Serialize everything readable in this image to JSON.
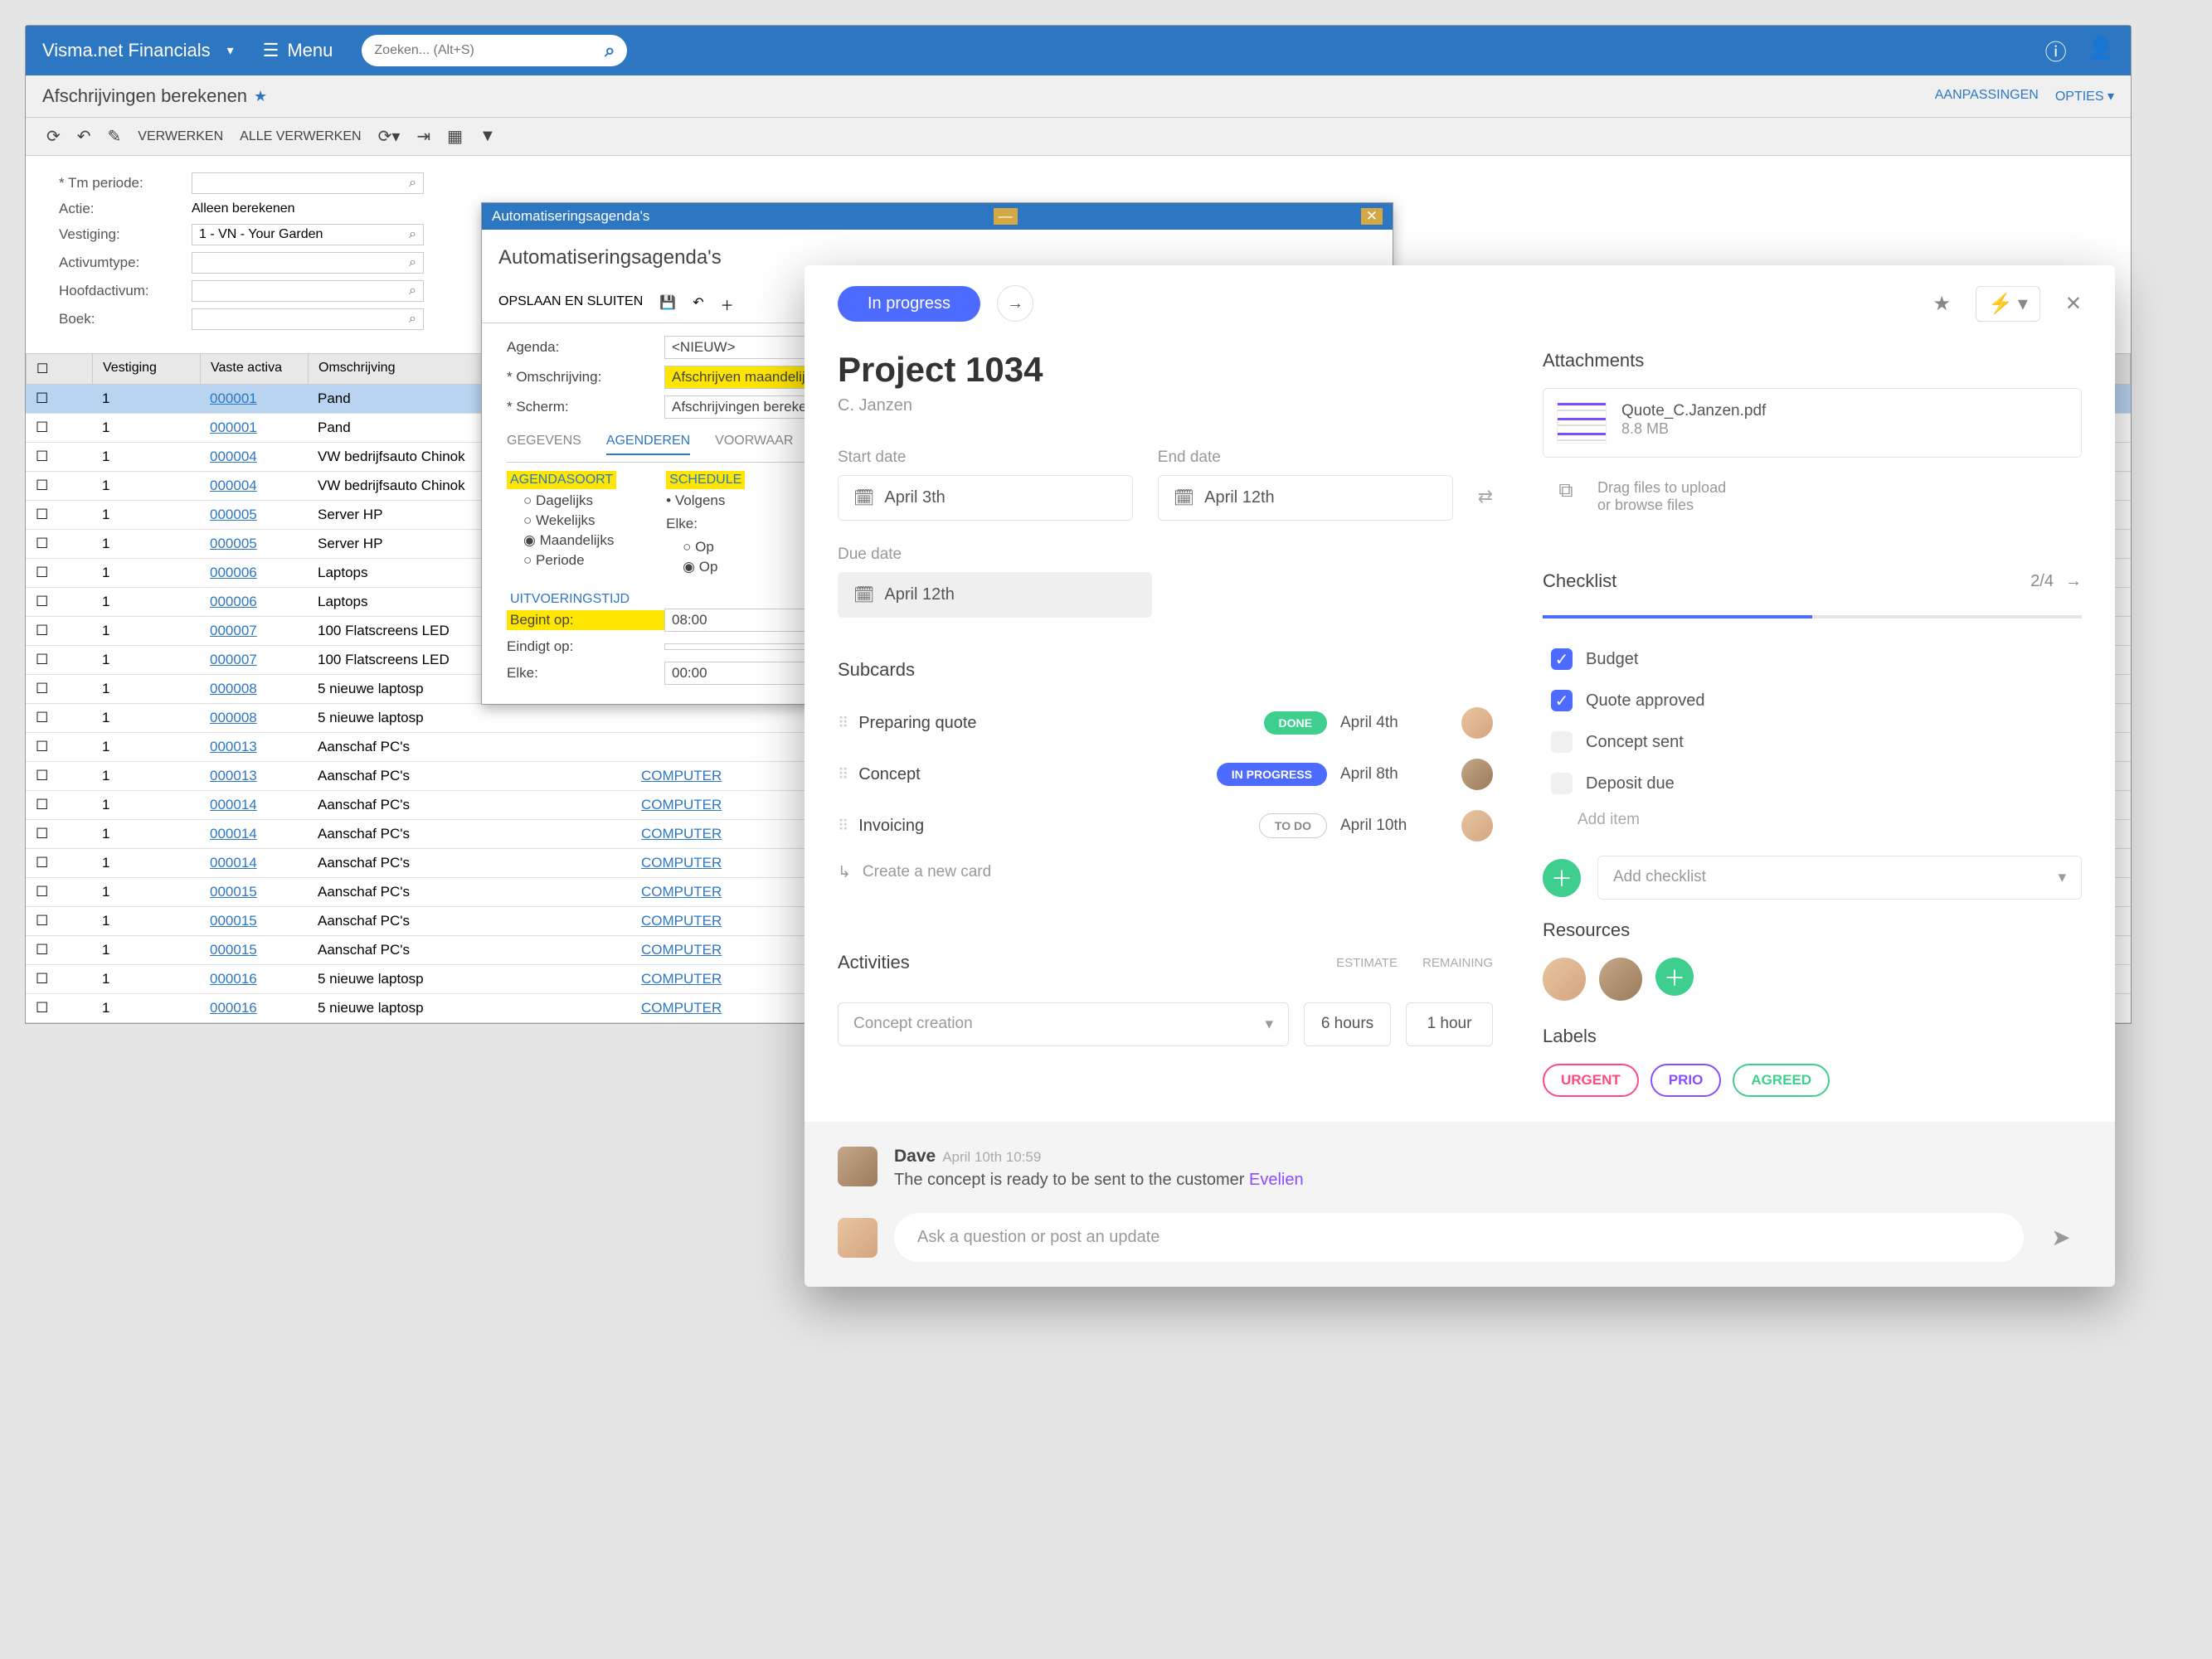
{
  "bg": {
    "brand": "Visma.net Financials",
    "menu": "Menu",
    "search_placeholder": "Zoeken... (Alt+S)",
    "page_title": "Afschrijvingen berekenen",
    "header_actions": {
      "adjust": "AANPASSINGEN",
      "options": "OPTIES"
    },
    "toolbar": {
      "verwerken": "VERWERKEN",
      "alle": "ALLE VERWERKEN"
    },
    "form": {
      "tm": {
        "label": "* Tm periode:"
      },
      "actie": {
        "label": "Actie:",
        "value": "Alleen berekenen"
      },
      "vestiging": {
        "label": "Vestiging:",
        "value": "1 - VN - Your Garden"
      },
      "activumtype": {
        "label": "Activumtype:"
      },
      "hoofdactivum": {
        "label": "Hoofdactivum:"
      },
      "boek": {
        "label": "Boek:"
      }
    },
    "grid": {
      "headers": {
        "vestiging": "Vestiging",
        "vaste_activa": "Vaste activa",
        "omschrijving": "Omschrijving"
      },
      "rows": [
        {
          "v": "1",
          "va": "000001",
          "oms": "Pand",
          "link": null,
          "sel": true
        },
        {
          "v": "1",
          "va": "000001",
          "oms": "Pand",
          "link": null
        },
        {
          "v": "1",
          "va": "000004",
          "oms": "VW bedrijfsauto Chinok",
          "link": null
        },
        {
          "v": "1",
          "va": "000004",
          "oms": "VW bedrijfsauto Chinok",
          "link": null
        },
        {
          "v": "1",
          "va": "000005",
          "oms": "Server HP",
          "link": null
        },
        {
          "v": "1",
          "va": "000005",
          "oms": "Server HP",
          "link": null
        },
        {
          "v": "1",
          "va": "000006",
          "oms": "Laptops",
          "link": null
        },
        {
          "v": "1",
          "va": "000006",
          "oms": "Laptops",
          "link": null
        },
        {
          "v": "1",
          "va": "000007",
          "oms": "100 Flatscreens LED",
          "link": null
        },
        {
          "v": "1",
          "va": "000007",
          "oms": "100 Flatscreens LED",
          "link": null
        },
        {
          "v": "1",
          "va": "000008",
          "oms": "5 nieuwe laptosp",
          "link": null
        },
        {
          "v": "1",
          "va": "000008",
          "oms": "5 nieuwe laptosp",
          "link": null
        },
        {
          "v": "1",
          "va": "000013",
          "oms": "Aanschaf PC's",
          "link": null
        },
        {
          "v": "1",
          "va": "000013",
          "oms": "Aanschaf PC's",
          "link": "COMPUTER"
        },
        {
          "v": "1",
          "va": "000014",
          "oms": "Aanschaf PC's",
          "link": "COMPUTER"
        },
        {
          "v": "1",
          "va": "000014",
          "oms": "Aanschaf PC's",
          "link": "COMPUTER"
        },
        {
          "v": "1",
          "va": "000014",
          "oms": "Aanschaf PC's",
          "link": "COMPUTER"
        },
        {
          "v": "1",
          "va": "000015",
          "oms": "Aanschaf PC's",
          "link": "COMPUTER"
        },
        {
          "v": "1",
          "va": "000015",
          "oms": "Aanschaf PC's",
          "link": "COMPUTER"
        },
        {
          "v": "1",
          "va": "000015",
          "oms": "Aanschaf PC's",
          "link": "COMPUTER"
        },
        {
          "v": "1",
          "va": "000016",
          "oms": "5 nieuwe laptosp",
          "link": "COMPUTER"
        },
        {
          "v": "1",
          "va": "000016",
          "oms": "5 nieuwe laptosp",
          "link": "COMPUTER"
        }
      ]
    },
    "modal": {
      "titlebar": "Automatiseringsagenda's",
      "heading": "Automatiseringsagenda's",
      "save_close": "OPSLAAN EN SLUITEN",
      "fields": {
        "agenda": {
          "label": "Agenda:",
          "value": "<NIEUW>"
        },
        "omschrijving": {
          "label": "* Omschrijving:",
          "value": "Afschrijven maandelijks"
        },
        "scherm": {
          "label": "* Scherm:",
          "value": "Afschrijvingen berekene"
        }
      },
      "tabs": {
        "gegevens": "GEGEVENS",
        "agenderen": "AGENDEREN",
        "voorwaar": "VOORWAAR"
      },
      "agendasoort": "AGENDASOORT",
      "schedule": "SCHEDULE",
      "radios": {
        "dagelijks": "Dagelijks",
        "wekelijks": "Wekelijks",
        "maandelijks": "Maandelijks",
        "periode": "Periode"
      },
      "volgens": "Volgens",
      "elke": "Elke:",
      "uitvoeringstijd": "UITVOERINGSTIJD",
      "times": {
        "begint": {
          "label": "Begint op:",
          "value": "08:00"
        },
        "eindigt": {
          "label": "Eindigt op:",
          "value": ""
        },
        "elke": {
          "label": "Elke:",
          "value": "00:00"
        }
      }
    }
  },
  "card": {
    "status": "In progress",
    "title": "Project 1034",
    "subtitle": "C. Janzen",
    "dates": {
      "start": {
        "label": "Start date",
        "value": "April 3th"
      },
      "end": {
        "label": "End date",
        "value": "April 12th"
      },
      "due": {
        "label": "Due date",
        "value": "April 12th"
      }
    },
    "subcards": {
      "title": "Subcards",
      "items": [
        {
          "name": "Preparing quote",
          "status": "DONE",
          "status_class": "done",
          "date": "April 4th"
        },
        {
          "name": "Concept",
          "status": "IN PROGRESS",
          "status_class": "prog",
          "date": "April 8th"
        },
        {
          "name": "Invoicing",
          "status": "TO DO",
          "status_class": "todo",
          "date": "April 10th"
        }
      ],
      "new_card": "Create a new card"
    },
    "activities": {
      "title": "Activities",
      "estimate": "ESTIMATE",
      "remaining": "REMAINING",
      "select_label": "Concept creation",
      "estimate_val": "6 hours",
      "remaining_val": "1 hour"
    },
    "attachments": {
      "title": "Attachments",
      "file_name": "Quote_C.Janzen.pdf",
      "file_size": "8.8 MB",
      "drop_text": "Drag files to upload",
      "drop_sub": "or browse files"
    },
    "checklist": {
      "title": "Checklist",
      "count": "2/4",
      "items": [
        {
          "text": "Budget",
          "checked": true
        },
        {
          "text": "Quote approved",
          "checked": true
        },
        {
          "text": "Concept sent",
          "checked": false
        },
        {
          "text": "Deposit due",
          "checked": false
        }
      ],
      "add_item": "Add item",
      "add_checklist": "Add checklist"
    },
    "resources": {
      "title": "Resources"
    },
    "labels": {
      "title": "Labels",
      "items": [
        {
          "text": "URGENT",
          "class": "label-urgent"
        },
        {
          "text": "PRIO",
          "class": "label-prio"
        },
        {
          "text": "AGREED",
          "class": "label-agreed"
        }
      ]
    },
    "comment": {
      "author": "Dave",
      "time": "April 10th 10:59",
      "text": "The concept is ready to be sent to the customer ",
      "mention": "Evelien"
    },
    "compose_placeholder": "Ask a question or post an update"
  }
}
